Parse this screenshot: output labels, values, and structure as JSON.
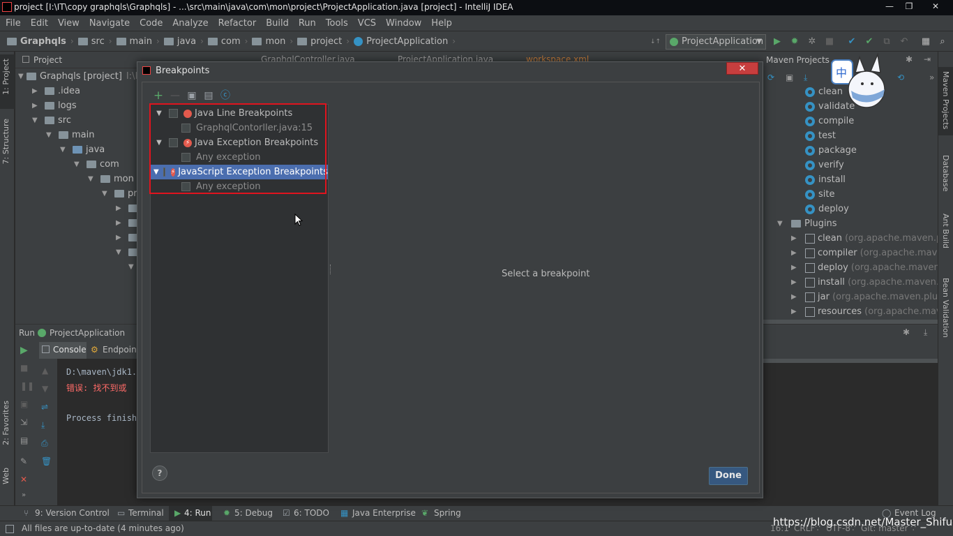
{
  "titlebar": {
    "text": "project [I:\\IT\\copy graphqls\\Graphqls] - ...\\src\\main\\java\\com\\mon\\project\\ProjectApplication.java [project] - IntelliJ IDEA",
    "min": "—",
    "max": "❐",
    "close": "✕"
  },
  "menu": [
    "File",
    "Edit",
    "View",
    "Navigate",
    "Code",
    "Analyze",
    "Refactor",
    "Build",
    "Run",
    "Tools",
    "VCS",
    "Window",
    "Help"
  ],
  "breadcrumbs": [
    "Graphqls",
    "src",
    "main",
    "java",
    "com",
    "mon",
    "project",
    "ProjectApplication"
  ],
  "run_config": "ProjectApplication",
  "left_tabs": {
    "project": "1: Project",
    "structure": "7: Structure",
    "favorites": "2: Favorites",
    "web": "Web"
  },
  "project": {
    "title": "Project",
    "tree": [
      {
        "label": "Graphqls [project]",
        "extra": "I:\\I"
      },
      {
        "label": ".idea"
      },
      {
        "label": "logs"
      },
      {
        "label": "src"
      },
      {
        "label": "main"
      },
      {
        "label": "java"
      },
      {
        "label": "com"
      },
      {
        "label": "mon"
      },
      {
        "label": "pr"
      }
    ]
  },
  "editor_tabs": [
    "GraphqlController.java",
    "ProjectApplication.java",
    "workspace.xml"
  ],
  "maven": {
    "title": "Maven Projects",
    "lifecycle": [
      "clean",
      "validate",
      "compile",
      "test",
      "package",
      "verify",
      "install",
      "site",
      "deploy"
    ],
    "plugins_label": "Plugins",
    "plugins": [
      {
        "name": "clean",
        "group": "(org.apache.maven.plug"
      },
      {
        "name": "compiler",
        "group": "(org.apache.maven."
      },
      {
        "name": "deploy",
        "group": "(org.apache.maven.pl"
      },
      {
        "name": "install",
        "group": "(org.apache.maven.plu"
      },
      {
        "name": "jar",
        "group": "(org.apache.maven.plugins"
      },
      {
        "name": "resources",
        "group": "(org.apache.maven"
      }
    ]
  },
  "right_tabs": {
    "maven": "Maven Projects",
    "database": "Database",
    "ant": "Ant Build",
    "bean": "Bean Validation"
  },
  "sticker_char": "中",
  "run": {
    "label": "Run",
    "config": "ProjectApplication",
    "tabs": [
      "Console",
      "Endpoint"
    ],
    "console": [
      {
        "text": "D:\\maven\\jdk1.",
        "color": "#a9b7c6"
      },
      {
        "text": "错误: 找不到或",
        "color": "#ff6b68"
      },
      {
        "text": "Process finish",
        "color": "#a9b7c6"
      }
    ]
  },
  "dialog": {
    "title": "Breakpoints",
    "close": "✕",
    "placeholder": "Select a breakpoint",
    "done": "Done",
    "help": "?",
    "tools": [
      "+",
      "—"
    ],
    "groups": [
      {
        "label": "Java Line Breakpoints",
        "child": "GraphqlContorller.java:15"
      },
      {
        "label": "Java Exception Breakpoints",
        "child": "Any exception"
      },
      {
        "label": "JavaScript Exception Breakpoints",
        "child": "Any exception"
      }
    ]
  },
  "bottom_tabs": [
    "9: Version Control",
    "Terminal",
    "4: Run",
    "5: Debug",
    "6: TODO",
    "Java Enterprise",
    "Spring"
  ],
  "event_log": "Event Log",
  "status": {
    "message": "All files are up-to-date (4 minutes ago)",
    "position": "16:1",
    "line_sep": "CRLF∵",
    "encoding": "UTF-8∵",
    "git": "Git: master ∵",
    "watermark": "https://blog.csdn.net/Master_Shifu"
  },
  "colors": {
    "selection": "#4b6eaf",
    "highlight_box": "#e0141e",
    "run_green": "#59a869",
    "error_red": "#ff6b68"
  }
}
